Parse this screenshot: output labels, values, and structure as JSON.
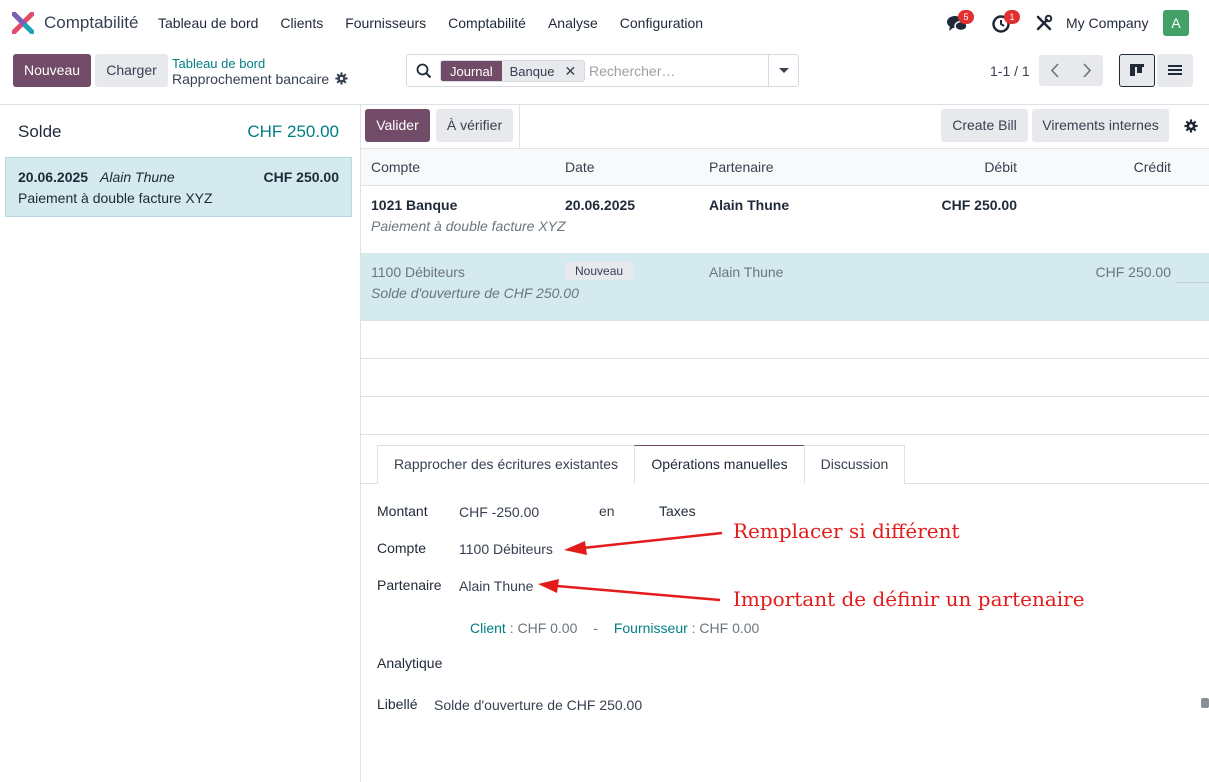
{
  "navbar": {
    "app_title": "Comptabilité",
    "menu": [
      "Tableau de bord",
      "Clients",
      "Fournisseurs",
      "Comptabilité",
      "Analyse",
      "Configuration"
    ],
    "messages_count": "5",
    "activities_count": "1",
    "company": "My Company",
    "avatar_letter": "A"
  },
  "control_panel": {
    "new_label": "Nouveau",
    "upload_label": "Charger",
    "breadcrumb_parent": "Tableau de bord",
    "breadcrumb_current": "Rapprochement bancaire",
    "search": {
      "facet_label": "Journal",
      "facet_value": "Banque",
      "placeholder": "Rechercher…"
    },
    "pager": "1-1 / 1"
  },
  "left_panel": {
    "balance_label": "Solde",
    "balance_amount": "CHF 250.00",
    "statement_line": {
      "date": "20.06.2025",
      "partner": "Alain Thune",
      "amount": "CHF 250.00",
      "label": "Paiement à double facture XYZ"
    }
  },
  "toolbar": {
    "validate_label": "Valider",
    "to_check_label": "À vérifier",
    "create_bill_label": "Create Bill",
    "internal_transfers_label": "Virements internes"
  },
  "table": {
    "headers": [
      "Compte",
      "Date",
      "Partenaire",
      "Débit",
      "Crédit"
    ],
    "rows": [
      {
        "account": "1021 Banque",
        "date": "20.06.2025",
        "partner": "Alain Thune",
        "debit": "CHF 250.00",
        "credit": "",
        "label": "Paiement à double facture XYZ"
      },
      {
        "account": "1100 Débiteurs",
        "badge": "Nouveau",
        "partner": "Alain Thune",
        "debit": "",
        "credit": "CHF 250.00",
        "label": "Solde d'ouverture de CHF 250.00"
      }
    ]
  },
  "tabs": [
    "Rapprocher des écritures existantes",
    "Opérations manuelles",
    "Discussion"
  ],
  "form": {
    "amount_label": "Montant",
    "amount_value": "CHF -250.00",
    "currency_prefix": "en",
    "taxes_label": "Taxes",
    "account_label": "Compte",
    "account_value": "1100 Débiteurs",
    "partner_label": "Partenaire",
    "partner_value": "Alain Thune",
    "client_label": "Client",
    "client_value": ": CHF 0.00",
    "separator": "-",
    "supplier_label": "Fournisseur",
    "supplier_value": ": CHF 0.00",
    "analytic_label": "Analytique",
    "label_label": "Libellé",
    "label_value": "Solde d'ouverture de CHF 250.00"
  },
  "annotations": {
    "account_note": "Remplacer si différent",
    "partner_note": "Important de définir un partenaire"
  },
  "colors": {
    "primary": "#714b67",
    "teal": "#017e84",
    "selected_row": "#d4eaee",
    "annotation": "#e31b1b"
  }
}
